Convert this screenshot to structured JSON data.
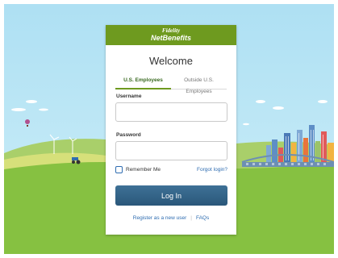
{
  "brand": {
    "logo_line1": "Fidelity",
    "logo_line2": "NetBenefits",
    "header_color": "#6e9a1f"
  },
  "login": {
    "title": "Welcome",
    "tabs": [
      {
        "label": "U.S. Employees",
        "active": true
      },
      {
        "label": "Outside U.S. Employees",
        "active": false
      }
    ],
    "username_label": "Username",
    "username_value": "",
    "password_label": "Password",
    "password_value": "",
    "remember_label": "Remember Me",
    "remember_checked": false,
    "forgot_label": "Forgot login?",
    "login_button": "Log In",
    "register_link": "Register as a new user",
    "faq_link": "FAQs"
  },
  "colors": {
    "sky": "#bfe5f5",
    "grass": "#86c141",
    "button": "#2f5f86",
    "link": "#2f6db1"
  }
}
